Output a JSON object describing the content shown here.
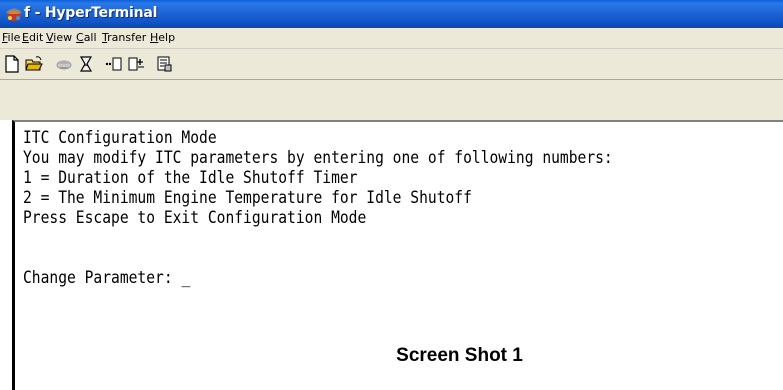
{
  "window": {
    "title": "f - HyperTerminal",
    "icon": "hyperterminal-phone-icon"
  },
  "menubar": {
    "items": [
      {
        "label": "File",
        "accel": "F",
        "rest": "ile"
      },
      {
        "label": "Edit",
        "accel": "E",
        "rest": "dit"
      },
      {
        "label": "View",
        "accel": "V",
        "rest": "iew"
      },
      {
        "label": "Call",
        "accel": "C",
        "rest": "all"
      },
      {
        "label": "Transfer",
        "accel": "T",
        "rest": "ransfer"
      },
      {
        "label": "Help",
        "accel": "H",
        "rest": "elp"
      }
    ]
  },
  "toolbar": {
    "buttons": [
      {
        "icon": "new-document-icon",
        "enabled": true
      },
      {
        "icon": "open-folder-icon",
        "enabled": true
      },
      {
        "icon": "call-phone-icon",
        "enabled": false
      },
      {
        "icon": "disconnect-icon",
        "enabled": true
      },
      {
        "icon": "send-file-icon",
        "enabled": true
      },
      {
        "icon": "receive-file-icon",
        "enabled": true
      },
      {
        "icon": "properties-icon",
        "enabled": true
      }
    ]
  },
  "terminal": {
    "lines": [
      "ITC Configuration Mode",
      "You may modify ITC parameters by entering one of following numbers:",
      "1 = Duration of the Idle Shutoff Timer",
      "2 = The Minimum Engine Temperature for Idle Shutoff",
      "Press Escape to Exit Configuration Mode",
      "",
      "Change Parameter: "
    ],
    "cursor": "_"
  },
  "caption": "Screen Shot 1"
}
